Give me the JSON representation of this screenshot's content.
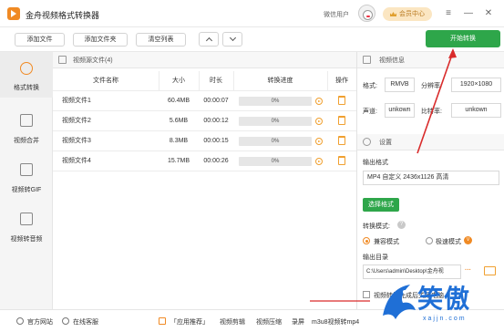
{
  "app": {
    "title": "金舟视频格式转换器"
  },
  "titlebar": {
    "user_name": "微信用户",
    "member_label": "会员中心",
    "win_controls": [
      "≡",
      "—",
      "✕"
    ]
  },
  "toolbar": {
    "add_file": "添加文件",
    "add_folder": "添加文件夹",
    "clear_list": "清空列表",
    "start_convert": "开始转换"
  },
  "sidebar": {
    "items": [
      {
        "label": "格式转换",
        "icon": "convert-icon"
      },
      {
        "label": "视频合并",
        "icon": "merge-icon"
      },
      {
        "label": "视频转GIF",
        "icon": "gif-icon"
      },
      {
        "label": "视频转音频",
        "icon": "audio-icon"
      }
    ]
  },
  "file_panel": {
    "header": "视频源文件(4)",
    "columns": [
      "文件名称",
      "大小",
      "时长",
      "转换进度",
      "操作"
    ],
    "rows": [
      {
        "name": "视频文件1",
        "size": "60.4MB",
        "duration": "00:00:07",
        "progress": "0%"
      },
      {
        "name": "视频文件2",
        "size": "5.6MB",
        "duration": "00:00:12",
        "progress": "0%"
      },
      {
        "name": "视频文件3",
        "size": "8.3MB",
        "duration": "00:00:15",
        "progress": "0%"
      },
      {
        "name": "视频文件4",
        "size": "15.7MB",
        "duration": "00:00:26",
        "progress": "0%"
      }
    ]
  },
  "video_info": {
    "header": "视频信息",
    "format_label": "格式:",
    "format_value": "RMVB",
    "resolution_label": "分辨率:",
    "resolution_value": "1920×1080",
    "channel_label": "声道:",
    "channel_value": "unkown",
    "bitrate_label": "比特率:",
    "bitrate_value": "unkown"
  },
  "settings": {
    "header": "设置",
    "output_format_label": "输出格式",
    "output_format_value": "MP4 自定义 2436x1126 高清",
    "choose_format": "选择格式",
    "mode_label": "转换模式:",
    "mode_compat": "兼容模式",
    "mode_fast": "极速模式",
    "vip_badge": "V",
    "output_dir_label": "输出目录",
    "output_dir_value": "C:\\Users\\admin\\Desktop\\金舟视",
    "browse": "···",
    "shutdown_label": "视频转换完成后关闭电脑"
  },
  "statusbar": {
    "website": "官方网站",
    "service": "在线客服",
    "links": [
      "「应用推荐」",
      "视频剪辑",
      "视频压缩",
      "录屏",
      "m3u8视频转mp4"
    ]
  },
  "watermark": {
    "text": "笑傲",
    "sub": "xajjn.com"
  }
}
